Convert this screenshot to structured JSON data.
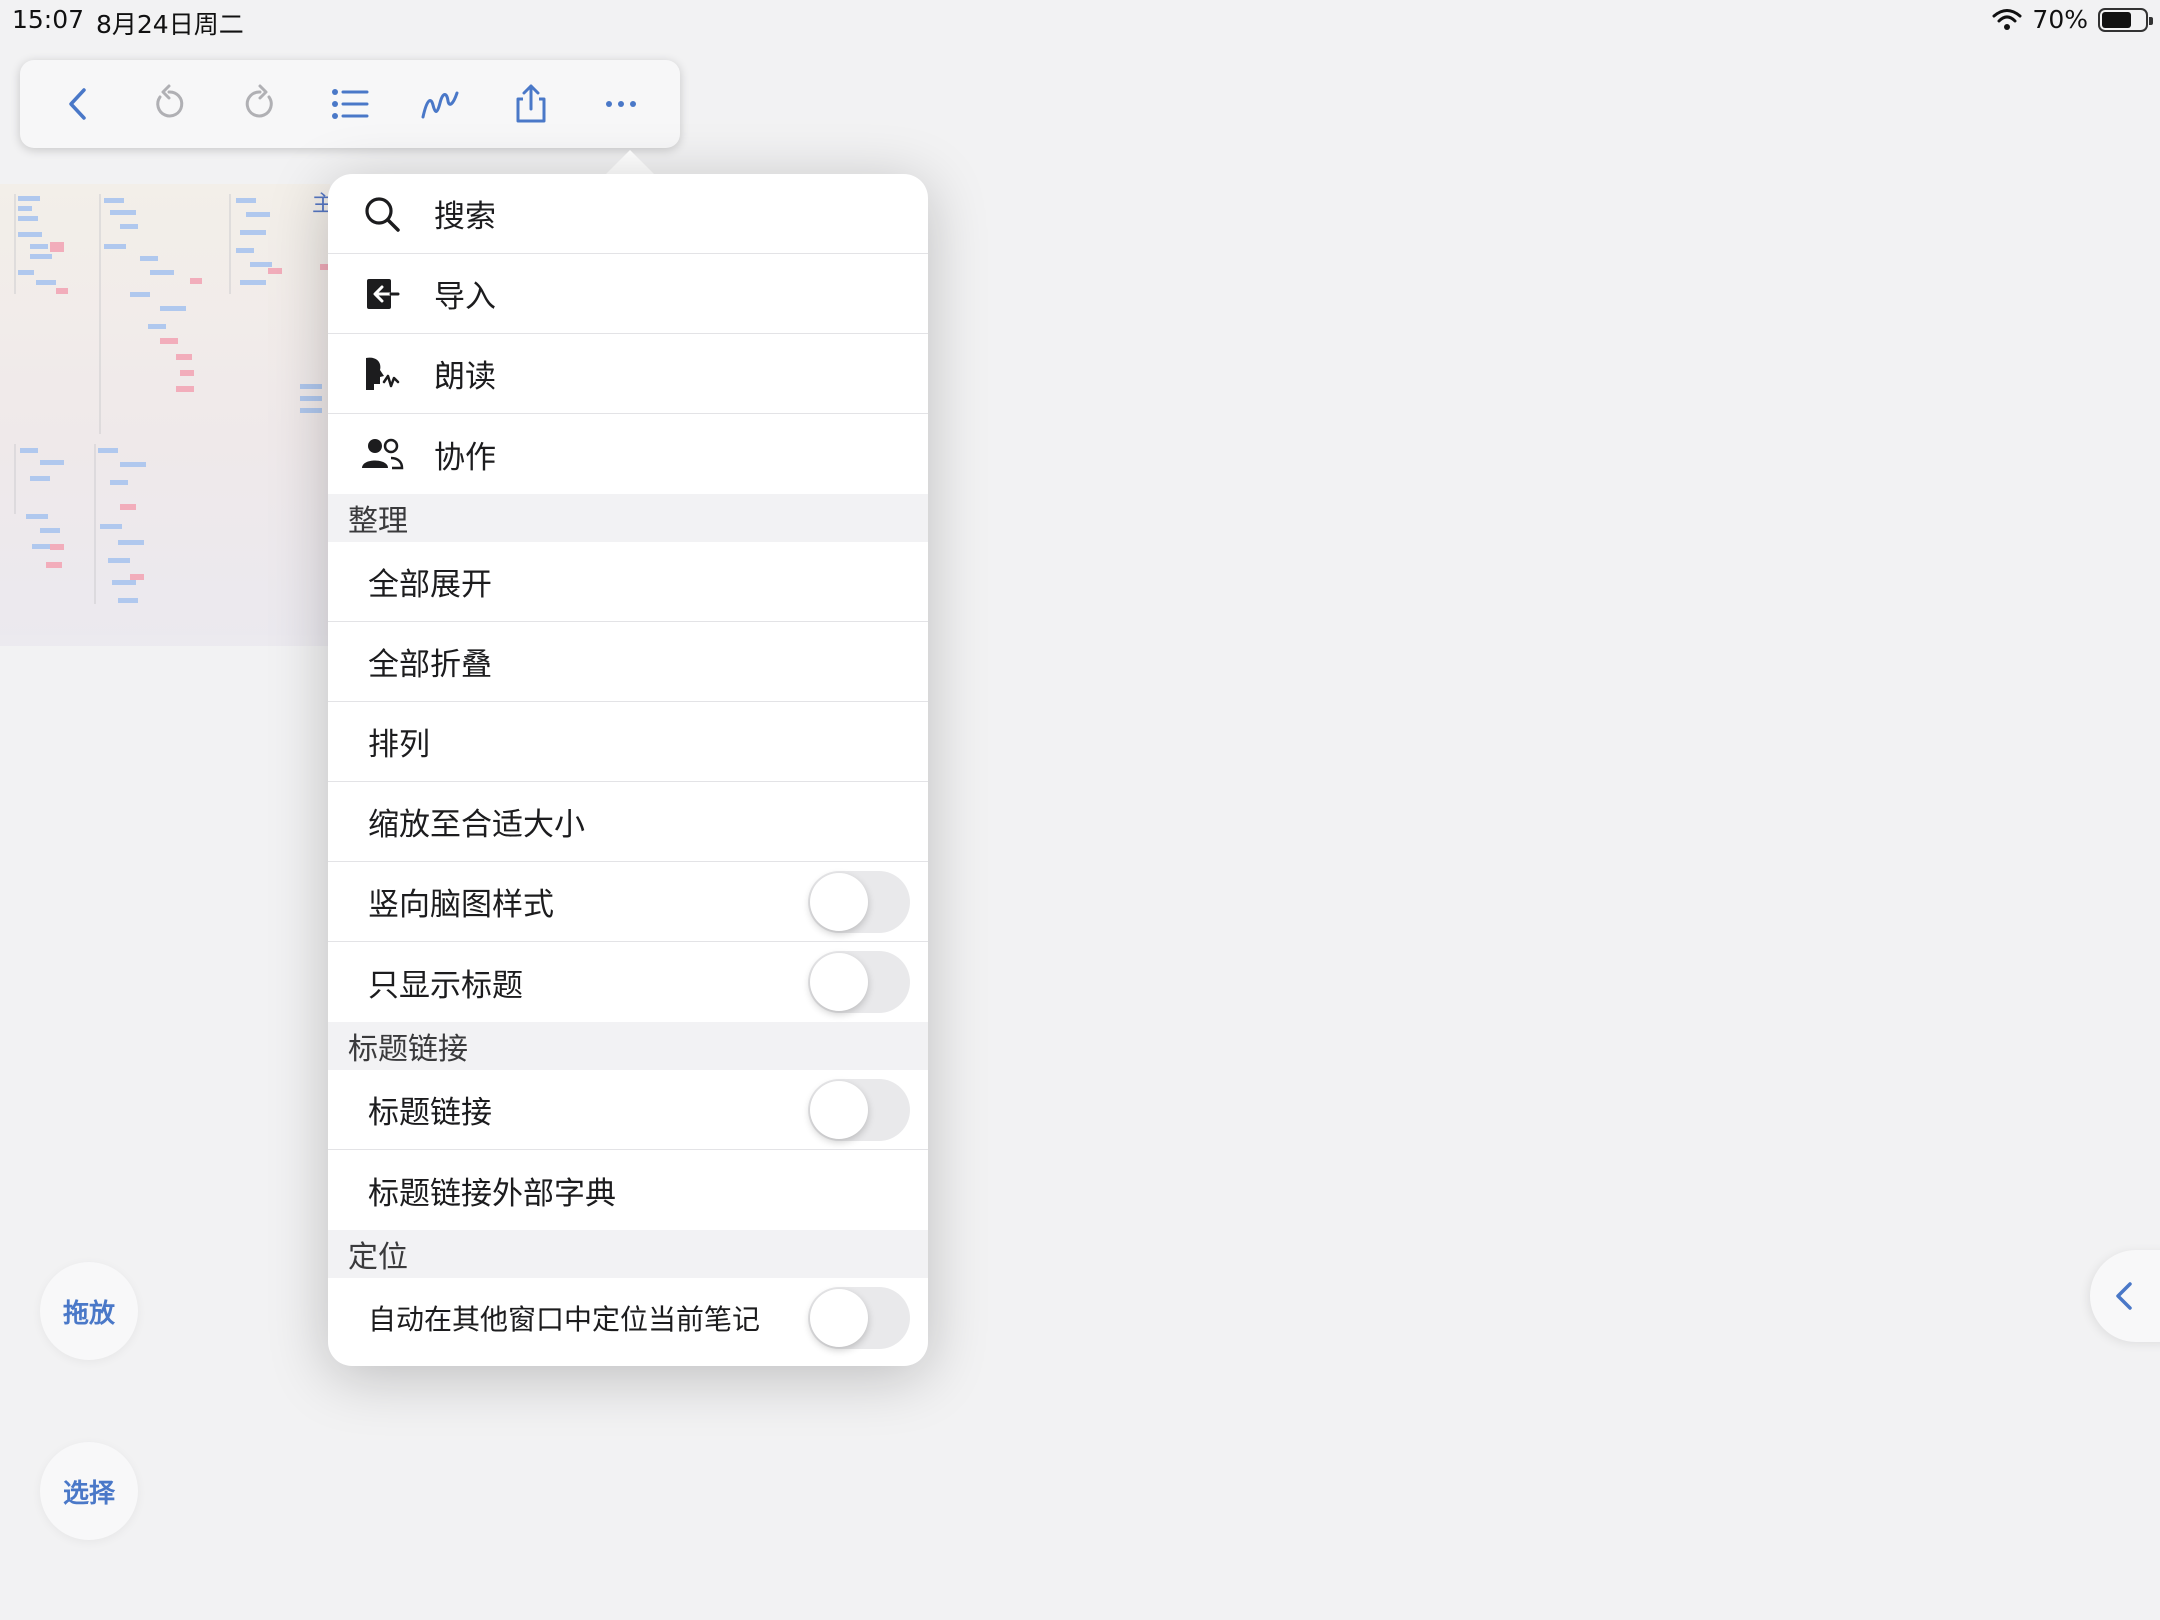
{
  "status_bar": {
    "time": "15:07",
    "date": "8月24日周二",
    "battery": "70%",
    "battery_level": 0.7
  },
  "toolbar": {
    "buttons": [
      "back-icon",
      "undo-icon",
      "redo-icon",
      "outline-list-icon",
      "pen-icon",
      "share-icon",
      "more-icon"
    ],
    "accent_color": "#4a78c8"
  },
  "mindmap": {
    "peek_text": "主"
  },
  "menu": {
    "items": [
      {
        "label": "搜索",
        "icon": "search-icon"
      },
      {
        "label": "导入",
        "icon": "import-icon"
      },
      {
        "label": "朗读",
        "icon": "read-aloud-icon"
      },
      {
        "label": "协作",
        "icon": "collaborate-icon"
      }
    ],
    "section_organize": {
      "title": "整理",
      "expand_all": "全部展开",
      "collapse_all": "全部折叠",
      "arrange": "排列",
      "zoom_to_fit": "缩放至合适大小",
      "vertical_style": "竖向脑图样式",
      "vertical_style_on": false,
      "titles_only": "只显示标题",
      "titles_only_on": false
    },
    "section_title_link": {
      "title": "标题链接",
      "title_link": "标题链接",
      "title_link_on": false,
      "external_dictionary": "标题链接外部字典"
    },
    "section_locate": {
      "title": "定位",
      "auto_locate": "自动在其他窗口中定位当前笔记",
      "auto_locate_on": false
    }
  },
  "fab": {
    "drag": "拖放",
    "select": "选择"
  }
}
